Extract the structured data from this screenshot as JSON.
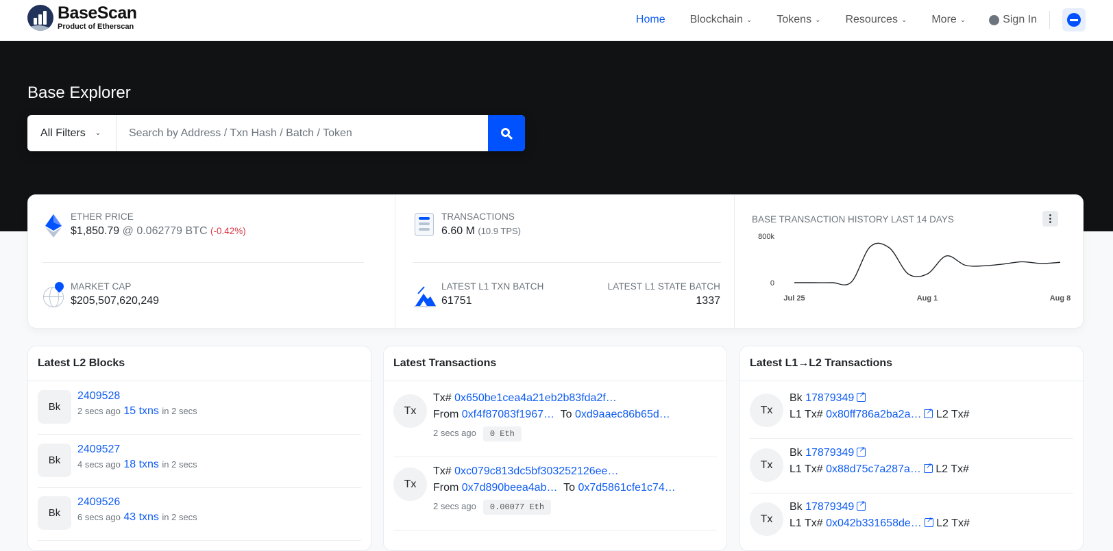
{
  "nav": {
    "logo_title": "BaseScan",
    "logo_sub": "Product of Etherscan",
    "items": [
      "Home",
      "Blockchain",
      "Tokens",
      "Resources",
      "More"
    ],
    "sign_in": "Sign In"
  },
  "hero": {
    "title": "Base Explorer",
    "filter": "All Filters",
    "search_placeholder": "Search by Address / Txn Hash / Batch / Token"
  },
  "stats": {
    "ether_price_label": "ETHER PRICE",
    "ether_price": "$1,850.79",
    "ether_btc": "@ 0.062779 BTC",
    "ether_change": "(-0.42%)",
    "market_cap_label": "MARKET CAP",
    "market_cap": "$205,507,620,249",
    "transactions_label": "TRANSACTIONS",
    "transactions": "6.60 M",
    "tps": "(10.9 TPS)",
    "l1_txn_batch_label": "LATEST L1 TXN BATCH",
    "l1_txn_batch": "61751",
    "l1_state_batch_label": "LATEST L1 STATE BATCH",
    "l1_state_batch": "1337"
  },
  "chart_data": {
    "type": "line",
    "title": "BASE TRANSACTION HISTORY LAST 14 DAYS",
    "x": [
      "Jul 25",
      "Jul 26",
      "Jul 27",
      "Jul 28",
      "Jul 29",
      "Jul 30",
      "Jul 31",
      "Aug 1",
      "Aug 2",
      "Aug 3",
      "Aug 4",
      "Aug 5",
      "Aug 6",
      "Aug 7",
      "Aug 8"
    ],
    "values": [
      0,
      0,
      0,
      10000,
      620000,
      600000,
      150000,
      150000,
      460000,
      300000,
      290000,
      320000,
      360000,
      330000,
      350000
    ],
    "xticks": [
      "Jul 25",
      "Aug 1",
      "Aug 8"
    ],
    "yticks": [
      "800k",
      "0"
    ],
    "ylim": [
      0,
      800000
    ],
    "color": "#212529"
  },
  "blocks": {
    "title": "Latest L2 Blocks",
    "badge": "Bk",
    "items": [
      {
        "number": "2409528",
        "age": "2 secs ago",
        "txns": "15 txns",
        "in": "in 2 secs"
      },
      {
        "number": "2409527",
        "age": "4 secs ago",
        "txns": "18 txns",
        "in": "in 2 secs"
      },
      {
        "number": "2409526",
        "age": "6 secs ago",
        "txns": "43 txns",
        "in": "in 2 secs"
      }
    ]
  },
  "transactions": {
    "title": "Latest Transactions",
    "badge": "Tx",
    "items": [
      {
        "hash": "0x650be1cea4a21eb2b83fda2f…",
        "from": "0xf4f87083f1967…",
        "to": "0xd9aaec86b65d…",
        "age": "2 secs ago",
        "value": "0 Eth"
      },
      {
        "hash": "0xc079c813dc5bf303252126ee…",
        "from": "0x7d890beea4ab…",
        "to": "0x7d5861cfe1c74…",
        "age": "2 secs ago",
        "value": "0.00077 Eth"
      }
    ],
    "tx_prefix": "Tx#",
    "from_label": "From",
    "to_label": "To"
  },
  "l1l2": {
    "title": "Latest L1→L2 Transactions",
    "badge": "Tx",
    "items": [
      {
        "block": "17879349",
        "l1tx": "0x80ff786a2ba2a…"
      },
      {
        "block": "17879349",
        "l1tx": "0x88d75c7a287a…"
      },
      {
        "block": "17879349",
        "l1tx": "0x042b331658de…"
      }
    ],
    "bk_prefix": "Bk",
    "l1_prefix": "L1 Tx#",
    "l2_prefix": "L2 Tx#"
  }
}
